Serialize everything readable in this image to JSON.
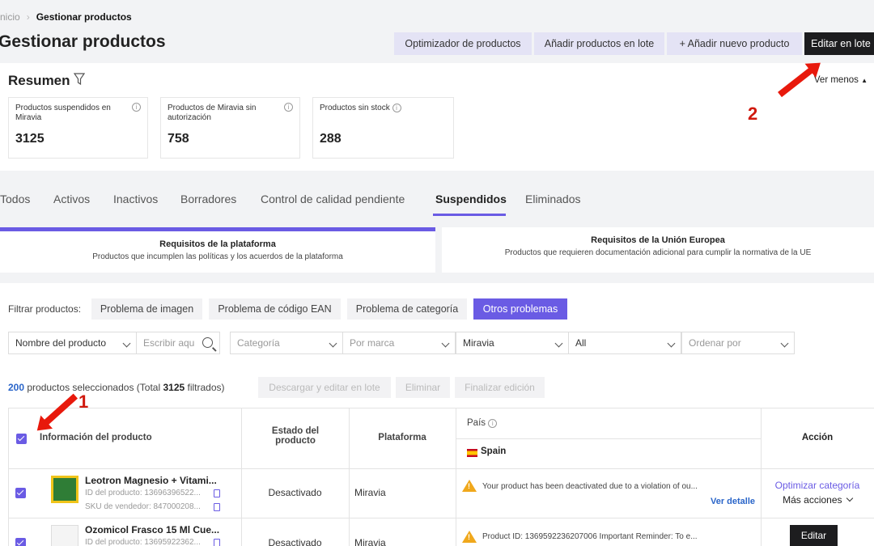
{
  "breadcrumb": {
    "home": "nicio",
    "current": "Gestionar productos"
  },
  "header": {
    "title": "Gestionar productos",
    "buttons": [
      "Optimizador de productos",
      "Añadir productos en lote",
      "+ Añadir nuevo producto",
      "Editar en lote"
    ]
  },
  "summary": {
    "title": "Resumen",
    "toggle": "Ver menos",
    "cards": [
      {
        "label": "Productos suspendidos en Miravia",
        "value": "3125"
      },
      {
        "label": "Productos de Miravia sin autorización",
        "value": "758"
      },
      {
        "label": "Productos sin stock",
        "value": "288"
      }
    ]
  },
  "tabs": [
    "Todos",
    "Activos",
    "Inactivos",
    "Borradores",
    "Control de calidad pendiente",
    "Suspendidos",
    "Eliminados"
  ],
  "subtabs": [
    {
      "title": "Requisitos de la plataforma",
      "desc": "Productos que incumplen las políticas y los acuerdos de la plataforma"
    },
    {
      "title": "Requisitos de la Unión Europea",
      "desc": "Productos que requieren documentación adicional para cumplir la normativa de la UE"
    }
  ],
  "filters": {
    "label": "Filtrar productos:",
    "chips": [
      "Problema de imagen",
      "Problema de código EAN",
      "Problema de categoría",
      "Otros problemas"
    ],
    "selects": {
      "field": "Nombre del producto",
      "search_placeholder": "Escribir aqu",
      "category": "Categoría",
      "brand": "Por marca",
      "platform": "Miravia",
      "all": "All",
      "sort": "Ordenar por"
    }
  },
  "selection": {
    "count": "200",
    "text1": " productos seleccionados (Total ",
    "total": "3125",
    "text2": " filtrados)",
    "actions": [
      "Descargar y editar en lote",
      "Eliminar",
      "Finalizar edición"
    ]
  },
  "table": {
    "headers": {
      "info": "Información del producto",
      "status": "Estado del producto",
      "platform": "Plataforma",
      "country": "País",
      "country_value": "Spain",
      "action": "Acción"
    },
    "rows": [
      {
        "name": "Leotron Magnesio + Vitami...",
        "id": "ID del producto: 13696396522...",
        "sku": "SKU de vendedor: 847000208...",
        "status": "Desactivado",
        "platform": "Miravia",
        "msg": "Your product has been deactivated due to a violation of ou...",
        "link": "Ver detalle",
        "action1": "Optimizar categoría",
        "action2": "Más acciones"
      },
      {
        "name": "Ozomicol Frasco 15 Ml Cue...",
        "id": "ID del producto: 13695922362...",
        "status": "Desactivado",
        "platform": "Miravia",
        "msg": "Product ID: 1369592236207006 Important Reminder: To e...",
        "action1": "Editar"
      }
    ]
  },
  "annotations": [
    "1",
    "2"
  ],
  "colors": {
    "accent": "#6a5be4",
    "link": "#2a65c9",
    "dark": "#1d1d1f",
    "arrow": "#e8190c"
  }
}
